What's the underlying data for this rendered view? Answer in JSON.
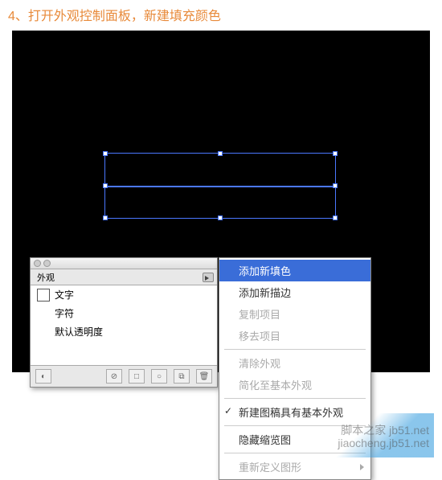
{
  "heading": "4、打开外观控制面板，新建填充颜色",
  "panel": {
    "tab_label": "外观",
    "rows": {
      "text": "文字",
      "char": "字符",
      "opacity": "默认透明度"
    }
  },
  "menu": {
    "add_fill": "添加新填色",
    "add_stroke": "添加新描边",
    "duplicate": "复制项目",
    "remove": "移去项目",
    "clear": "清除外观",
    "reduce": "简化至基本外观",
    "new_basic": "新建图稿具有基本外观",
    "hide_thumb": "隐藏缩览图",
    "redefine": "重新定义图形"
  },
  "watermark": {
    "line1": "脚本之家 jb51.net",
    "line2": "jiaocheng.jb51.net"
  }
}
